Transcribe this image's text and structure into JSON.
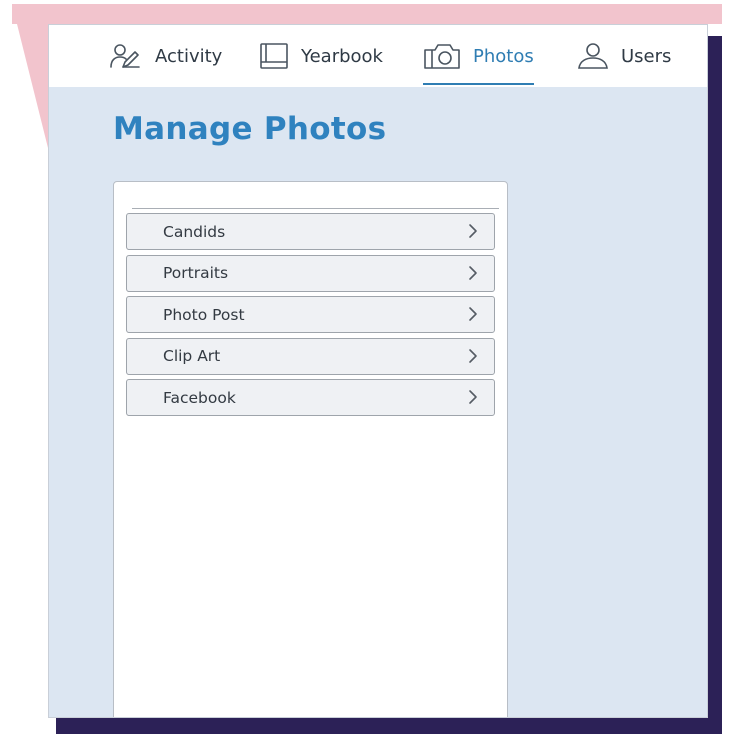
{
  "nav": {
    "items": [
      {
        "label": "Activity",
        "icon": "activity-icon",
        "active": false
      },
      {
        "label": "Yearbook",
        "icon": "yearbook-icon",
        "active": false
      },
      {
        "label": "Photos",
        "icon": "camera-icon",
        "active": true
      },
      {
        "label": "Users",
        "icon": "user-icon",
        "active": false
      }
    ]
  },
  "page": {
    "title": "Manage Photos"
  },
  "categories": [
    {
      "label": "Candids"
    },
    {
      "label": "Portraits"
    },
    {
      "label": "Photo Post"
    },
    {
      "label": "Clip Art"
    },
    {
      "label": "Facebook"
    }
  ],
  "colors": {
    "accent": "#2f82bf",
    "page_background": "#dce6f2",
    "pink_backdrop": "#f2c4cd",
    "navy_backdrop": "#2c2157"
  }
}
